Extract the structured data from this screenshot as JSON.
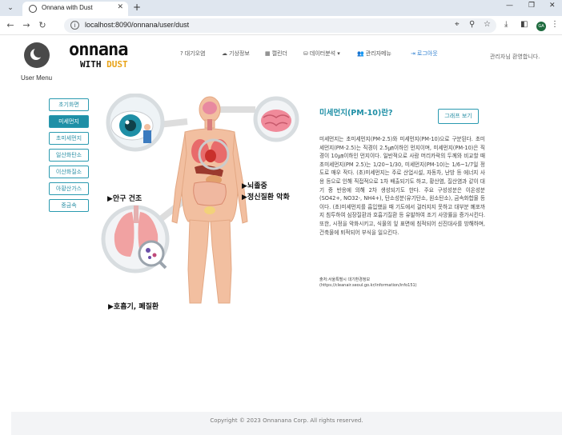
{
  "browser": {
    "tab_title": "Onnana with Dust",
    "url": "localhost:8090/onnana/user/dust",
    "profile_initials": "GA"
  },
  "header": {
    "user_menu_label": "User Menu",
    "logo_line1": "onnana",
    "logo_line2_a": "WITH ",
    "logo_line2_b": "DUST",
    "nav": [
      {
        "label": "대기오염",
        "icon": "question-icon"
      },
      {
        "label": "기상정보",
        "icon": "weather-icon"
      },
      {
        "label": "캘린더",
        "icon": "calendar-icon"
      },
      {
        "label": "데이터분석",
        "icon": "database-icon"
      },
      {
        "label": "관리자메뉴",
        "icon": "users-icon"
      },
      {
        "label": "로그아웃",
        "icon": "logout-icon"
      }
    ],
    "welcome": "관리자님 환영합니다."
  },
  "sidemenu": {
    "items": [
      {
        "label": "초기화면"
      },
      {
        "label": "미세먼지",
        "active": true
      },
      {
        "label": "초미세먼지"
      },
      {
        "label": "일산화탄소"
      },
      {
        "label": "이산화질소"
      },
      {
        "label": "아황산가스"
      },
      {
        "label": "중금속"
      }
    ]
  },
  "illustration": {
    "captions": {
      "eye": "▶안구 건조",
      "brain_1": "▶뇌졸중",
      "brain_2": "▶정신질환 악화",
      "lung": "▶호흡기, 폐질환"
    }
  },
  "content": {
    "heading": "미세먼지(PM-10)란?",
    "graph_button": "그래프 보기",
    "paragraph": "미세먼지는 초미세먼지(PM-2.5)와 미세먼지(PM-10)으로 구분된다. 초미세먼지(PM-2.5)는 직경이 2.5㎛이하인 먼지이며, 미세먼지(PM-10)은 직경이 10㎛이하인 먼지이다. 일반적으로 사람 머리카락의 두께와 비교할 때 초미세먼지(PM 2.5)는 1/20~1/30, 미세먼지(PM-10)는 1/6~1/7일 정도로 매우 작다. (초)미세먼지는 주로 산업시설, 자동차, 난방 등 에너지 사용 등으로 인해 직접적으로 1차 배출되기도 하고, 황산염, 질산염과 같이 대기 중 반응에 의해 2차 생성되기도 한다. 주요 구성성분은 이온성분(SO42+, NO32-, NH4+), 탄소성분(유기탄소, 원소탄소), 금속화합물 등이다. (초)미세먼지를 흡입했을 때 기도에서 걸러지지 못하고 대부분 폐포까지 침투하여 심장질환과 호흡기질환 등 유발하여 조기 사망률을 증가시킨다. 또한, 시정을 악화시키고, 식물의 잎 표면에 침적되어 신진대사를 방해하며, 건축물에 퇴적되어 부식을 일으킨다.",
    "source_line1": "출처:서울특별시 대기환경정보",
    "source_line2": "(https://cleanair.seoul.go.kr/information/info151)"
  },
  "footer": {
    "copyright": "Copyright © 2023 Onnanana Corp. All rights reserved."
  },
  "colors": {
    "accent": "#1f8fa6",
    "logo_accent": "#e8a317",
    "link": "#2d7fd0"
  }
}
